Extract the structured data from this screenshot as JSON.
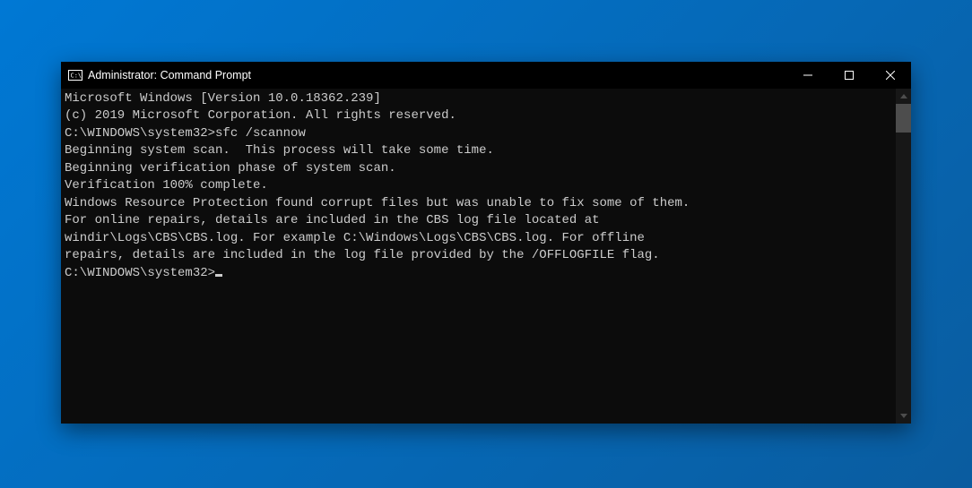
{
  "window": {
    "title": "Administrator: Command Prompt"
  },
  "terminal": {
    "lines": {
      "l0": "Microsoft Windows [Version 10.0.18362.239]",
      "l1": "(c) 2019 Microsoft Corporation. All rights reserved.",
      "l2": "",
      "l3": "C:\\WINDOWS\\system32>sfc /scannow",
      "l4": "",
      "l5": "Beginning system scan.  This process will take some time.",
      "l6": "",
      "l7": "Beginning verification phase of system scan.",
      "l8": "Verification 100% complete.",
      "l9": "",
      "l10": "Windows Resource Protection found corrupt files but was unable to fix some of them.",
      "l11": "For online repairs, details are included in the CBS log file located at",
      "l12": "windir\\Logs\\CBS\\CBS.log. For example C:\\Windows\\Logs\\CBS\\CBS.log. For offline",
      "l13": "repairs, details are included in the log file provided by the /OFFLOGFILE flag.",
      "l14": "",
      "l15": "C:\\WINDOWS\\system32>"
    }
  }
}
